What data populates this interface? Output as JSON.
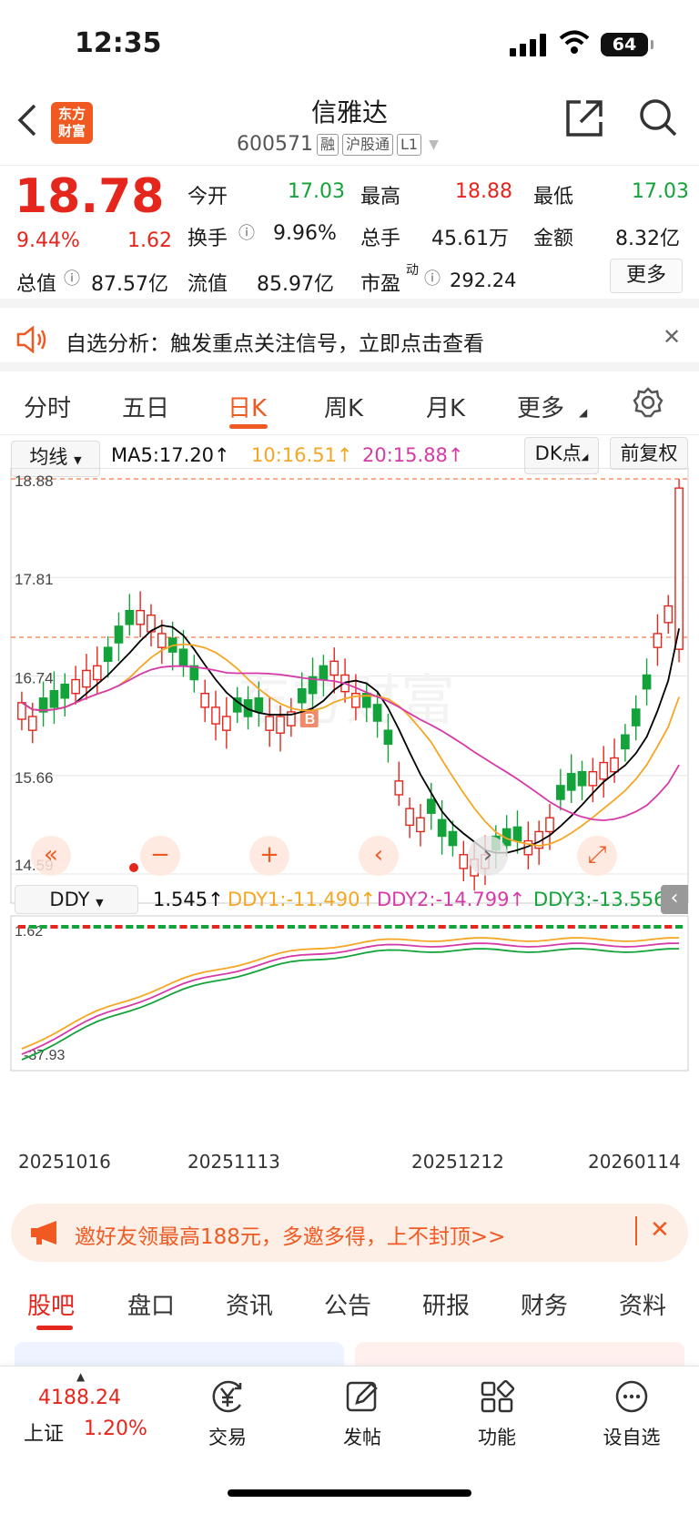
{
  "status": {
    "time": "12:35",
    "battery": "64"
  },
  "header": {
    "logo_line1": "东方",
    "logo_line2": "财富",
    "name": "信雅达",
    "code": "600571",
    "tags": [
      "融",
      "沪股通",
      "L1"
    ]
  },
  "quote": {
    "price": "18.78",
    "pct": "9.44%",
    "chg": "1.62",
    "open_label": "今开",
    "open": "17.03",
    "high_label": "最高",
    "high": "18.88",
    "low_label": "最低",
    "low": "17.03",
    "turnover_label": "换手",
    "turnover": "9.96%",
    "volume_label": "总手",
    "volume": "45.61万",
    "amount_label": "金额",
    "amount": "8.32亿",
    "mcap_label": "总值",
    "mcap": "87.57亿",
    "float_label": "流值",
    "float": "85.97亿",
    "pe_label": "市盈",
    "pe_sup": "动",
    "pe": "292.24",
    "more": "更多"
  },
  "notice": {
    "text": "自选分析：触发重点关注信号，立即点击查看"
  },
  "period_tabs": [
    "分时",
    "五日",
    "日K",
    "周K",
    "月K",
    "更多"
  ],
  "period_active": "日K",
  "kline_toolbar": {
    "indicator_select": "均线",
    "ma5": "MA5:17.20↑",
    "ma10": "10:16.51↑",
    "ma20": "20:15.88↑",
    "dk": "DK点",
    "adjust": "前复权"
  },
  "sub_toolbar": {
    "indicator_select": "DDY",
    "ddy": "1.545↑",
    "ddy1": "DDY1:-11.490↑",
    "ddy2": "DDY2:-14.799↑",
    "ddy3": "DDY3:-13.556"
  },
  "chart_data": {
    "type": "candlestick",
    "y_ticks": [
      "18.88",
      "17.81",
      "16.74",
      "15.66",
      "14.59"
    ],
    "ylim": [
      14.59,
      18.88
    ],
    "sub_y_ticks": [
      "1.62",
      "-37.93"
    ],
    "x_ticks": [
      "20251016",
      "20251113",
      "20251212",
      "20260114"
    ],
    "marker": "B",
    "colors": {
      "up": "#e5261c",
      "down": "#14a33a",
      "ma5": "#000000",
      "ma10": "#f5a623",
      "ma20": "#d63aa8"
    }
  },
  "promo": {
    "text": "邀好友领最高188元，多邀多得，上不封顶>>"
  },
  "bottom_tabs": [
    "股吧",
    "盘口",
    "资讯",
    "公告",
    "研报",
    "财务",
    "资料"
  ],
  "index": {
    "value": "4188.24",
    "name": "上证",
    "pct": "1.20%"
  },
  "nav": [
    {
      "label": "交易",
      "icon": "yen-icon"
    },
    {
      "label": "发帖",
      "icon": "edit-icon"
    },
    {
      "label": "功能",
      "icon": "grid-icon"
    },
    {
      "label": "设自选",
      "icon": "more-icon"
    }
  ]
}
